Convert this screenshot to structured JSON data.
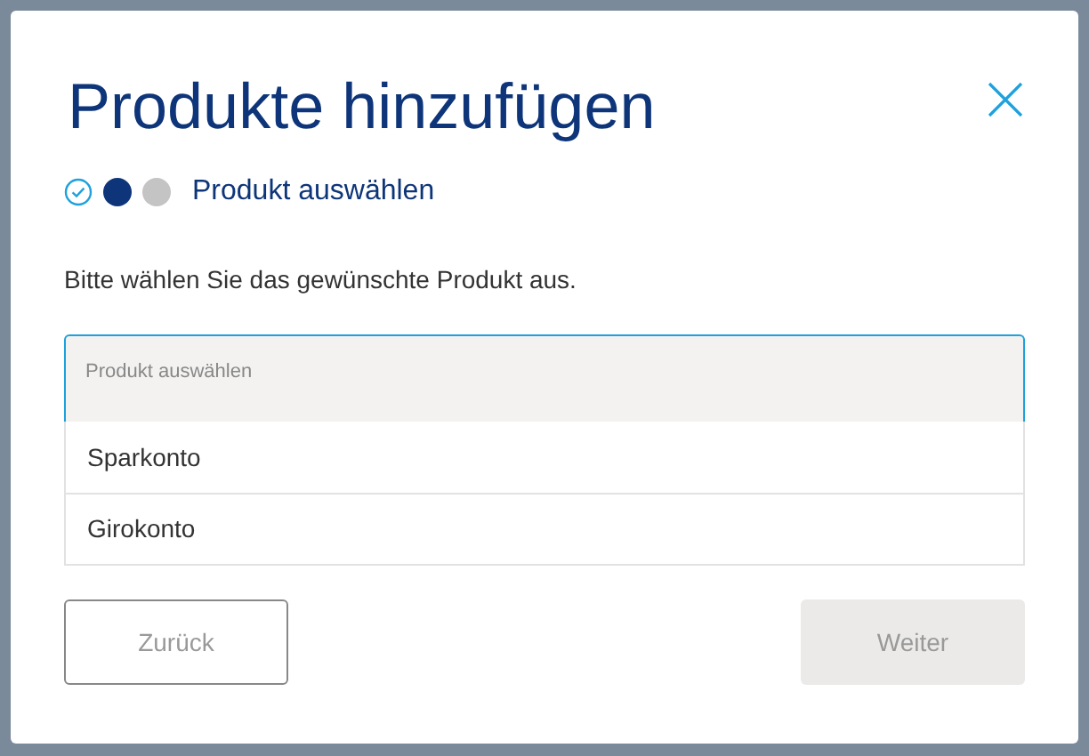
{
  "dialog": {
    "title": "Produkte hinzufügen",
    "steps": [
      {
        "kind": "done"
      },
      {
        "kind": "current"
      },
      {
        "kind": "upcoming"
      }
    ],
    "step_label": "Produkt auswählen",
    "instruction": "Bitte wählen Sie das gewünschte Produkt aus.",
    "select": {
      "label": "Produkt auswählen",
      "expanded": true,
      "options": [
        {
          "label": "Sparkonto"
        },
        {
          "label": "Girokonto"
        }
      ]
    },
    "buttons": [
      {
        "label": "Zurück",
        "kind": "secondary",
        "disabled": false
      },
      {
        "label": "Weiter",
        "kind": "primary",
        "disabled": true
      }
    ]
  }
}
